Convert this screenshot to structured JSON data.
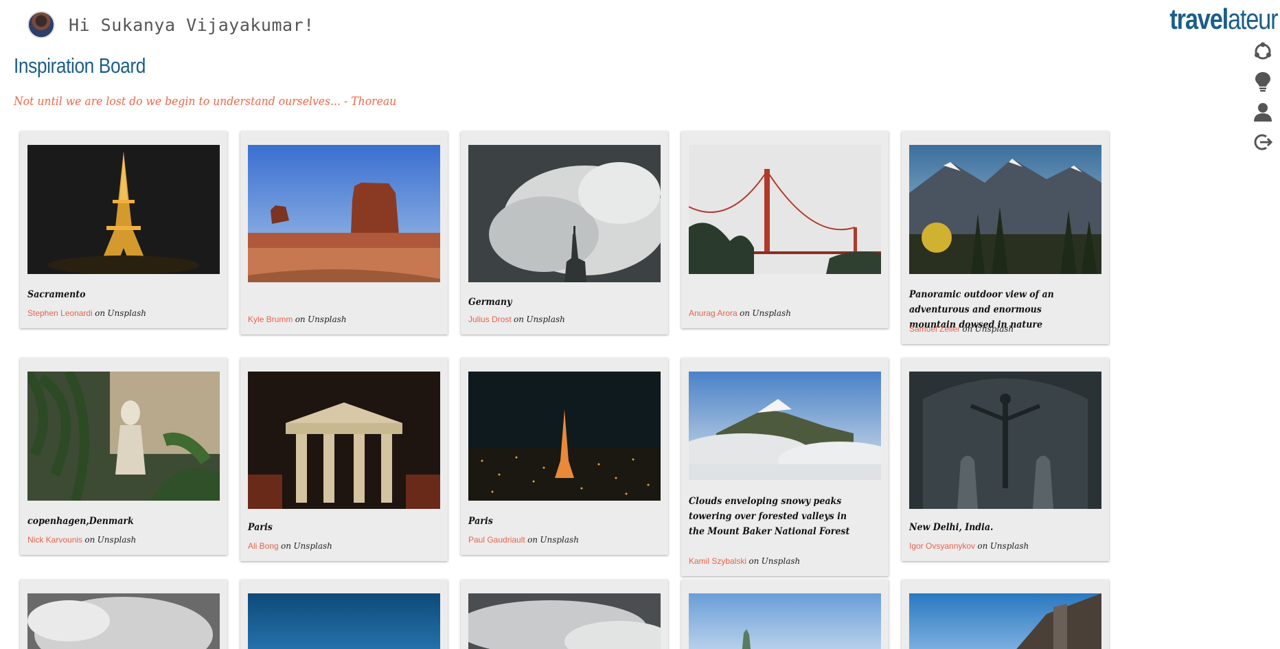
{
  "user": {
    "greeting": "Hi Sukanya Vijayakumar!"
  },
  "header": {
    "title": "Inspiration Board",
    "quote": "Not until we are lost do we begin to understand ourselves... - Thoreau",
    "brand_part1": "travel",
    "brand_part2": "ateur"
  },
  "nav_icons": [
    "explore-icon",
    "lightbulb-icon",
    "profile-icon",
    "logout-icon"
  ],
  "colors": {
    "brand": "#1b5e8a",
    "accent": "#f0674a",
    "card_bg": "#ececec"
  },
  "cards": [
    {
      "caption": "Sacramento",
      "author": "Stephen Leonardi",
      "on": "on",
      "site": "Unsplash"
    },
    {
      "caption": "",
      "author": "Kyle Brumm",
      "on": "on",
      "site": "Unsplash"
    },
    {
      "caption": "Germany",
      "author": "Julius Drost",
      "on": "on",
      "site": "Unsplash"
    },
    {
      "caption": "",
      "author": "Anurag Arora",
      "on": "on",
      "site": "Unsplash"
    },
    {
      "caption": "Panoramic outdoor view of an adventurous and enormous mountain dowsed in nature",
      "author": "Samuel Zeller",
      "on": "on",
      "site": "Unsplash"
    },
    {
      "caption": "copenhagen,Denmark",
      "author": "Nick Karvounis",
      "on": "on",
      "site": "Unsplash"
    },
    {
      "caption": "Paris",
      "author": "Ali Bong",
      "on": "on",
      "site": "Unsplash"
    },
    {
      "caption": "Paris",
      "author": "Paul Gaudriault",
      "on": "on",
      "site": "Unsplash"
    },
    {
      "caption": "Clouds enveloping snowy peaks towering over forested valleys in the Mount Baker National Forest",
      "author": "Kamil Szybalski",
      "on": "on",
      "site": "Unsplash"
    },
    {
      "caption": "New Delhi, India.",
      "author": "Igor Ovsyannykov",
      "on": "on",
      "site": "Unsplash"
    }
  ]
}
